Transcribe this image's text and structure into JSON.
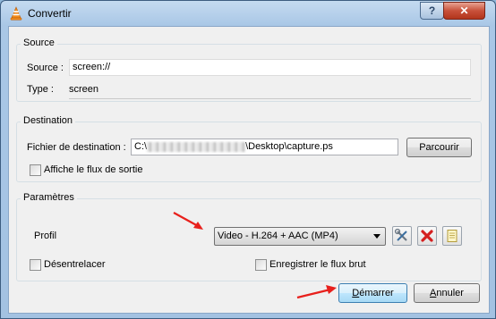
{
  "window": {
    "title": "Convertir",
    "help_label": "?",
    "close_label": "✕"
  },
  "source": {
    "group_title": "Source",
    "source_label": "Source :",
    "source_value": "screen://",
    "type_label": "Type :",
    "type_value": "screen"
  },
  "destination": {
    "group_title": "Destination",
    "file_label": "Fichier de destination :",
    "file_value_prefix": "C:\\",
    "file_value_suffix": "\\Desktop\\capture.ps",
    "browse_label": "Parcourir",
    "show_output_label": "Affiche le flux de sortie"
  },
  "parametres": {
    "group_title": "Paramètres",
    "profile_label": "Profil",
    "profile_selected": "Video - H.264 + AAC (MP4)",
    "deinterlace_label": "Désentrelacer",
    "raw_stream_label": "Enregistrer le flux brut"
  },
  "footer": {
    "start_first": "D",
    "start_rest": "émarrer",
    "cancel_first": "A",
    "cancel_rest": "nnuler"
  },
  "colors": {
    "annotation_arrow": "#e8201c",
    "delete_icon": "#d42020"
  }
}
